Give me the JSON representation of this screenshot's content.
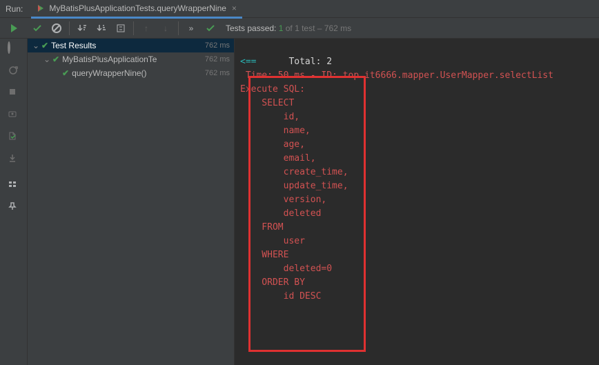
{
  "header": {
    "run_label": "Run:",
    "tab_title": "MyBatisPlusApplicationTests.queryWrapperNine"
  },
  "toolbar": {
    "tests_passed_prefix": "Tests passed:",
    "tests_passed_count": "1",
    "tests_passed_of": "of 1 test",
    "tests_passed_time": "– 762 ms"
  },
  "tree": {
    "root": {
      "label": "Test Results",
      "time": "762 ms"
    },
    "suite": {
      "label": "MyBatisPlusApplicationTe",
      "time": "762 ms"
    },
    "test": {
      "label": "queryWrapperNine()",
      "time": "762 ms"
    }
  },
  "console": {
    "line1_left": "<==",
    "line1_total_label": "Total:",
    "line1_total_value": "2",
    "line2": " Time: 50 ms - ID: top.it6666.mapper.UserMapper.selectList",
    "line3": "Execute SQL:",
    "sql": [
      "    SELECT",
      "        id,",
      "        name,",
      "        age,",
      "        email,",
      "        create_time,",
      "        update_time,",
      "        version,",
      "        deleted",
      "    FROM",
      "        user",
      "    WHERE",
      "        deleted=0",
      "    ORDER BY",
      "        id DESC"
    ]
  }
}
